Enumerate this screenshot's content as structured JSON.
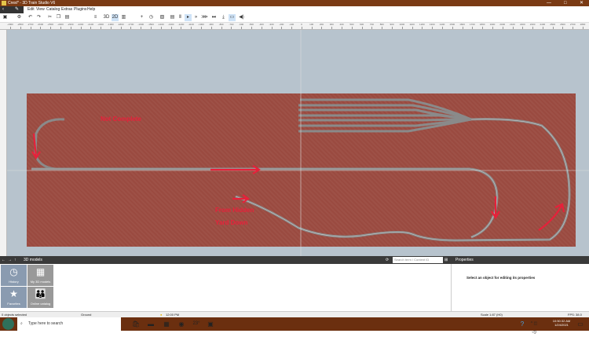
{
  "window": {
    "title": "Crest* - 3D Train Studio V6",
    "minimize": "—",
    "maximize": "□",
    "close": "✕"
  },
  "menu": [
    "Edit",
    "View",
    "Catalog",
    "Extras",
    "Plugins",
    "Help"
  ],
  "toolbar": {
    "view_3d": "3D",
    "view_2d": "2D"
  },
  "ruler_labels": [
    "-2900",
    "-2800",
    "-2700",
    "-2600",
    "-2500",
    "-2400",
    "-2300",
    "-2200",
    "-2100",
    "-2000",
    "-1900",
    "-1800",
    "-1700",
    "-1600",
    "-1500",
    "-1400",
    "-1300",
    "-1200",
    "-1100",
    "-1000",
    "-900",
    "-800",
    "-700",
    "-600",
    "-500",
    "-400",
    "-300",
    "-200",
    "-100",
    "0",
    "100",
    "200",
    "300",
    "400",
    "500",
    "600",
    "700",
    "800",
    "900",
    "1000",
    "1100",
    "1200",
    "1300",
    "1400",
    "1500",
    "1600",
    "1700",
    "1800",
    "1900",
    "2000",
    "2100",
    "2200",
    "2300",
    "2400",
    "2500",
    "2600",
    "2700",
    "2800"
  ],
  "layout_notes": {
    "not_complete": "Not Complete",
    "from_hidden_1": "From Hidden",
    "from_hidden_2": "Yard Down"
  },
  "panel": {
    "title": "3D models",
    "search_placeholder": "Search term / Content ID",
    "properties_title": "Properties",
    "properties_hint": "Select an object for editing its properties"
  },
  "tiles": [
    {
      "label": "History",
      "icon": "clock-icon"
    },
    {
      "label": "My 3D models",
      "icon": "grid-icon"
    },
    {
      "label": "Favorites",
      "icon": "star-icon"
    },
    {
      "label": "Online catalog",
      "icon": "people-icon"
    }
  ],
  "status": {
    "selected": "0 objects selected",
    "layer": "Ground",
    "time": "12:00 PM",
    "scale": "Scale 1:87 (H0)",
    "fps": "FPS: 38.0"
  },
  "taskbar": {
    "search": "Type here to search",
    "weather": "23°",
    "clock_time": "10:50:32 AM",
    "clock_date": "1/24/2021"
  },
  "colors": {
    "accent": "#e8203a",
    "board": "#9a4a40",
    "titlebar": "#7a3a14"
  }
}
